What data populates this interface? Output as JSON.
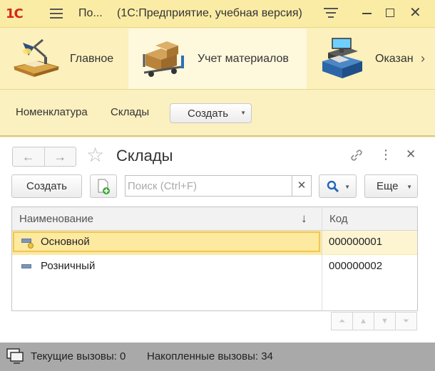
{
  "titlebar": {
    "logo": "1С",
    "short_title": "По...",
    "long_title": "(1С:Предприятие, учебная версия)"
  },
  "sections": [
    {
      "label": "Главное",
      "icon": "desk-lamp-icon"
    },
    {
      "label": "Учет материалов",
      "icon": "boxes-cart-icon"
    },
    {
      "label": "Оказан",
      "icon": "cash-register-icon"
    }
  ],
  "navbar": {
    "links": [
      "Номенклатура",
      "Склады"
    ],
    "create_label": "Создать"
  },
  "form": {
    "title": "Склады",
    "create_button": "Создать",
    "search_placeholder": "Поиск (Ctrl+F)",
    "more_button": "Еще",
    "columns": {
      "name": "Наименование",
      "code": "Код"
    },
    "rows": [
      {
        "name": "Основной",
        "code": "000000001",
        "selected": true
      },
      {
        "name": "Розничный",
        "code": "000000002",
        "selected": false
      }
    ]
  },
  "status": {
    "current_calls": "Текущие вызовы: 0",
    "accumulated_calls": "Накопленные вызовы: 34"
  },
  "colors": {
    "panel_bg": "#fbf0bf",
    "selected_row": "#fbeaa6",
    "focus_border": "#f0c850",
    "status_bg": "#a9a9a9"
  }
}
